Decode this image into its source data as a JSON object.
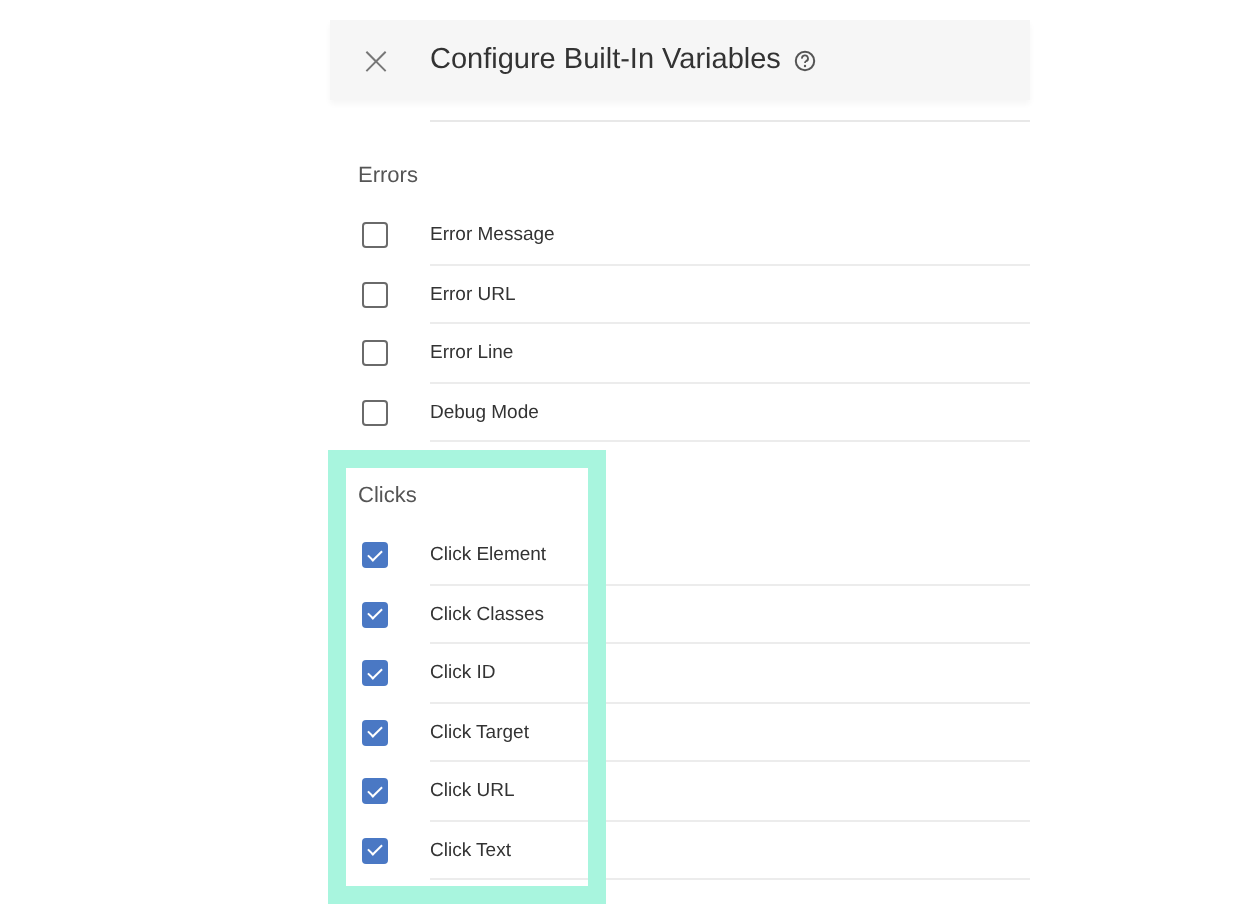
{
  "header": {
    "close": "×",
    "title": "Configure Built-In Variables"
  },
  "sections": [
    {
      "title": "Errors",
      "highlighted": false,
      "items": [
        {
          "label": "Error Message",
          "checked": false
        },
        {
          "label": "Error URL",
          "checked": false
        },
        {
          "label": "Error Line",
          "checked": false
        },
        {
          "label": "Debug Mode",
          "checked": false
        }
      ]
    },
    {
      "title": "Clicks",
      "highlighted": true,
      "items": [
        {
          "label": "Click Element",
          "checked": true
        },
        {
          "label": "Click Classes",
          "checked": true
        },
        {
          "label": "Click ID",
          "checked": true
        },
        {
          "label": "Click Target",
          "checked": true
        },
        {
          "label": "Click URL",
          "checked": true
        },
        {
          "label": "Click Text",
          "checked": true
        }
      ]
    }
  ]
}
